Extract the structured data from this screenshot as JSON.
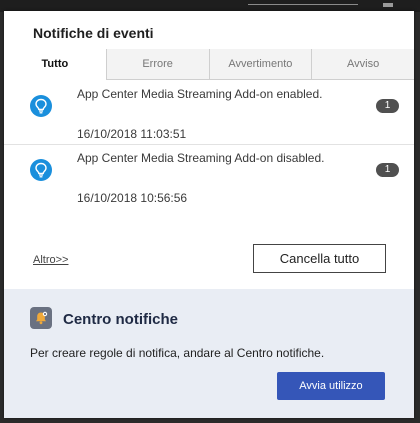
{
  "panel": {
    "title": "Notifiche di eventi"
  },
  "tabs": [
    {
      "label": "Tutto",
      "active": true
    },
    {
      "label": "Errore",
      "active": false
    },
    {
      "label": "Avvertimento",
      "active": false
    },
    {
      "label": "Avviso",
      "active": false
    }
  ],
  "notifications": [
    {
      "icon": "lightbulb-icon",
      "message": "App Center Media Streaming Add-on enabled.",
      "timestamp": "16/10/2018 11:03:51",
      "count": "1"
    },
    {
      "icon": "lightbulb-icon",
      "message": "App Center Media Streaming Add-on disabled.",
      "timestamp": "16/10/2018 10:56:56",
      "count": "1"
    }
  ],
  "footer": {
    "more_link": "Altro>>",
    "clear_all": "Cancella tutto"
  },
  "notification_center": {
    "icon": "notification-center-icon",
    "title": "Centro notifiche",
    "description": "Per creare regole di notifica, andare al Centro notifiche.",
    "button": "Avvia utilizzo"
  },
  "colors": {
    "info_icon": "#1a8fdc",
    "count_badge": "#505050",
    "primary_button": "#3556b8",
    "center_background": "#e9edf4"
  }
}
